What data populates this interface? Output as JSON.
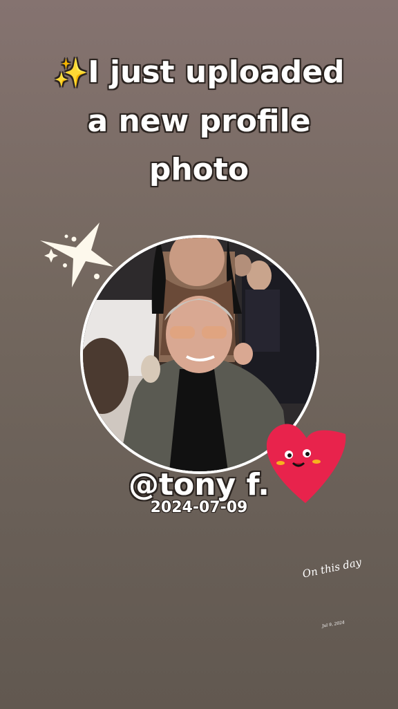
{
  "story": {
    "headline_prefix_emoji": "✨",
    "headline_lines": [
      "I just uploaded",
      "a new profile",
      "photo"
    ],
    "username": "@tony f.",
    "date": "2024-07-09",
    "memory_label": "On this day",
    "memory_date": "Jul 9, 2024"
  },
  "stickers": {
    "star": "sparkle-star-icon",
    "heart": "smiling-heart-icon"
  },
  "colors": {
    "background_top": "#857370",
    "background_bottom": "#615850",
    "heart": "#e8234c",
    "star": "#fdf8ec",
    "text": "#ffffff"
  }
}
